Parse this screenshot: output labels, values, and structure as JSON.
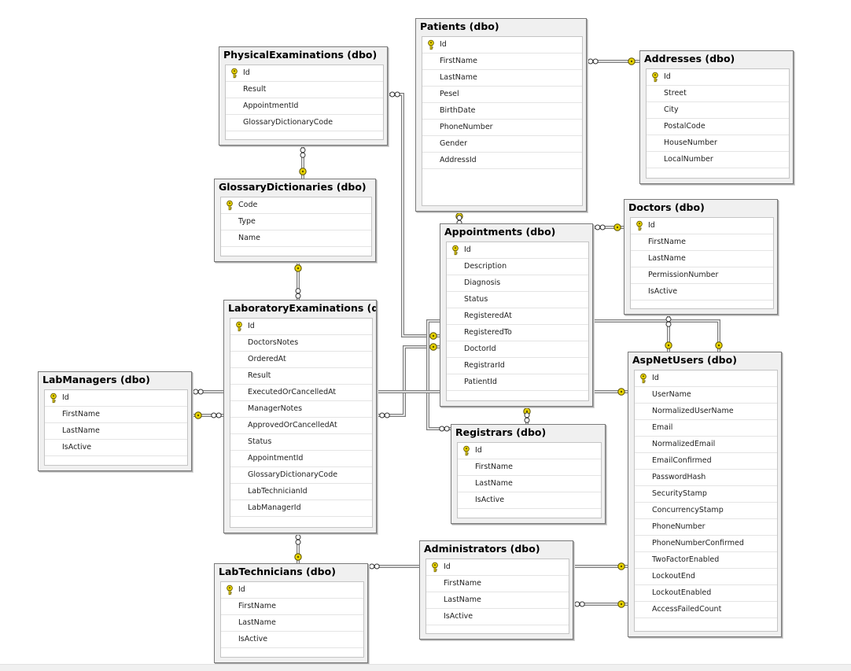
{
  "diagram": {
    "tables": [
      {
        "key": "physical",
        "title": "PhysicalExaminations (dbo)",
        "pk": [
          "Id"
        ],
        "columns": [
          "Id",
          "Result",
          "AppointmentId",
          "GlossaryDictionaryCode"
        ]
      },
      {
        "key": "patients",
        "title": "Patients (dbo)",
        "pk": [
          "Id"
        ],
        "columns": [
          "Id",
          "FirstName",
          "LastName",
          "Pesel",
          "BirthDate",
          "PhoneNumber",
          "Gender",
          "AddressId"
        ]
      },
      {
        "key": "addresses",
        "title": "Addresses (dbo)",
        "pk": [
          "Id"
        ],
        "columns": [
          "Id",
          "Street",
          "City",
          "PostalCode",
          "HouseNumber",
          "LocalNumber"
        ]
      },
      {
        "key": "glossary",
        "title": "GlossaryDictionaries (dbo)",
        "pk": [
          "Code"
        ],
        "columns": [
          "Code",
          "Type",
          "Name"
        ]
      },
      {
        "key": "appointments",
        "title": "Appointments (dbo)",
        "pk": [
          "Id"
        ],
        "columns": [
          "Id",
          "Description",
          "Diagnosis",
          "Status",
          "RegisteredAt",
          "RegisteredTo",
          "DoctorId",
          "RegistrarId",
          "PatientId"
        ]
      },
      {
        "key": "doctors",
        "title": "Doctors (dbo)",
        "pk": [
          "Id"
        ],
        "columns": [
          "Id",
          "FirstName",
          "LastName",
          "PermissionNumber",
          "IsActive"
        ]
      },
      {
        "key": "labexams",
        "title": "LaboratoryExaminations (dbo)",
        "pk": [
          "Id"
        ],
        "columns": [
          "Id",
          "DoctorsNotes",
          "OrderedAt",
          "Result",
          "ExecutedOrCancelledAt",
          "ManagerNotes",
          "ApprovedOrCancelledAt",
          "Status",
          "AppointmentId",
          "GlossaryDictionaryCode",
          "LabTechnicianId",
          "LabManagerId"
        ]
      },
      {
        "key": "labmanagers",
        "title": "LabManagers (dbo)",
        "pk": [
          "Id"
        ],
        "columns": [
          "Id",
          "FirstName",
          "LastName",
          "IsActive"
        ]
      },
      {
        "key": "aspnetusers",
        "title": "AspNetUsers (dbo)",
        "pk": [
          "Id"
        ],
        "columns": [
          "Id",
          "UserName",
          "NormalizedUserName",
          "Email",
          "NormalizedEmail",
          "EmailConfirmed",
          "PasswordHash",
          "SecurityStamp",
          "ConcurrencyStamp",
          "PhoneNumber",
          "PhoneNumberConfirmed",
          "TwoFactorEnabled",
          "LockoutEnd",
          "LockoutEnabled",
          "AccessFailedCount"
        ]
      },
      {
        "key": "registrars",
        "title": "Registrars (dbo)",
        "pk": [
          "Id"
        ],
        "columns": [
          "Id",
          "FirstName",
          "LastName",
          "IsActive"
        ]
      },
      {
        "key": "administrators",
        "title": "Administrators (dbo)",
        "pk": [
          "Id"
        ],
        "columns": [
          "Id",
          "FirstName",
          "LastName",
          "IsActive"
        ]
      },
      {
        "key": "labtechnicians",
        "title": "LabTechnicians (dbo)",
        "pk": [
          "Id"
        ],
        "columns": [
          "Id",
          "FirstName",
          "LastName",
          "IsActive"
        ]
      }
    ],
    "relationships": [
      {
        "from": "addresses",
        "to": "patients"
      },
      {
        "from": "physical",
        "to": "glossary"
      },
      {
        "from": "glossary",
        "to": "labexams"
      },
      {
        "from": "patients",
        "to": "appointments"
      },
      {
        "from": "doctors",
        "to": "appointments"
      },
      {
        "from": "appointments",
        "to": "physical"
      },
      {
        "from": "appointments",
        "to": "labexams"
      },
      {
        "from": "registrars",
        "to": "appointments"
      },
      {
        "from": "labmanagers",
        "to": "labexams"
      },
      {
        "from": "labtechnicians",
        "to": "labexams"
      },
      {
        "from": "aspnetusers",
        "to": "doctors"
      },
      {
        "from": "aspnetusers",
        "to": "registrars"
      },
      {
        "from": "aspnetusers",
        "to": "administrators"
      },
      {
        "from": "aspnetusers",
        "to": "labmanagers"
      },
      {
        "from": "aspnetusers",
        "to": "labtechnicians"
      }
    ],
    "colors": {
      "key_icon": "#e8d400",
      "line": "#7a7a7a",
      "title_bg": "#f0f0f0"
    }
  }
}
